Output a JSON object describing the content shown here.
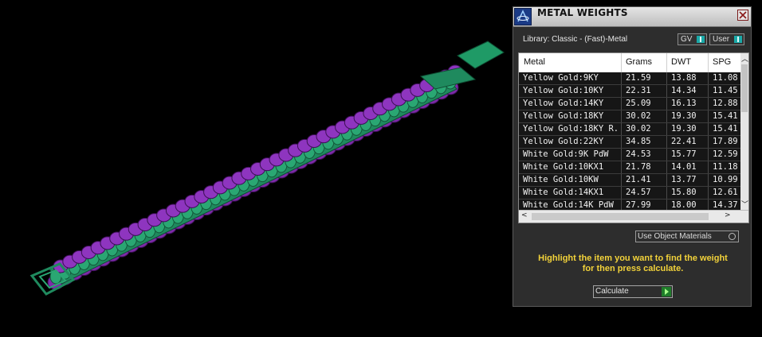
{
  "viewport": {
    "model_name": "bracelet-3d-model"
  },
  "panel": {
    "title": "METAL WEIGHTS",
    "library_label": "Library: Classic - (Fast)-Metal",
    "toggles": [
      {
        "label": "GV",
        "on": true
      },
      {
        "label": "User",
        "on": true
      }
    ],
    "table": {
      "headers": [
        "Metal",
        "Grams",
        "DWT",
        "SPG"
      ],
      "rows": [
        [
          "Yellow Gold:9KY",
          "21.59",
          "13.88",
          "11.08"
        ],
        [
          "Yellow Gold:10KY",
          "22.31",
          "14.34",
          "11.45"
        ],
        [
          "Yellow Gold:14KY",
          "25.09",
          "16.13",
          "12.88"
        ],
        [
          "Yellow Gold:18KY",
          "30.02",
          "19.30",
          "15.41"
        ],
        [
          "Yellow Gold:18KY R...",
          "30.02",
          "19.30",
          "15.41"
        ],
        [
          "Yellow Gold:22KY",
          "34.85",
          "22.41",
          "17.89"
        ],
        [
          "White Gold:9K PdW",
          "24.53",
          "15.77",
          "12.59"
        ],
        [
          "White Gold:10KX1",
          "21.78",
          "14.01",
          "11.18"
        ],
        [
          "White Gold:10KW",
          "21.41",
          "13.77",
          "10.99"
        ],
        [
          "White Gold:14KX1",
          "24.57",
          "15.80",
          "12.61"
        ],
        [
          "White Gold:14K PdW",
          "27.99",
          "18.00",
          "14.37"
        ]
      ]
    },
    "use_object_materials": "Use Object Materials",
    "hint_line1": "Highlight the item you want to find the weight",
    "hint_line2": "for then press calculate.",
    "calculate_label": "Calculate",
    "colors": {
      "accent": "#1aa9a8",
      "hint": "#f2d23a",
      "model_green": "#1f8a5e",
      "model_purple": "#7d2aa8"
    }
  }
}
